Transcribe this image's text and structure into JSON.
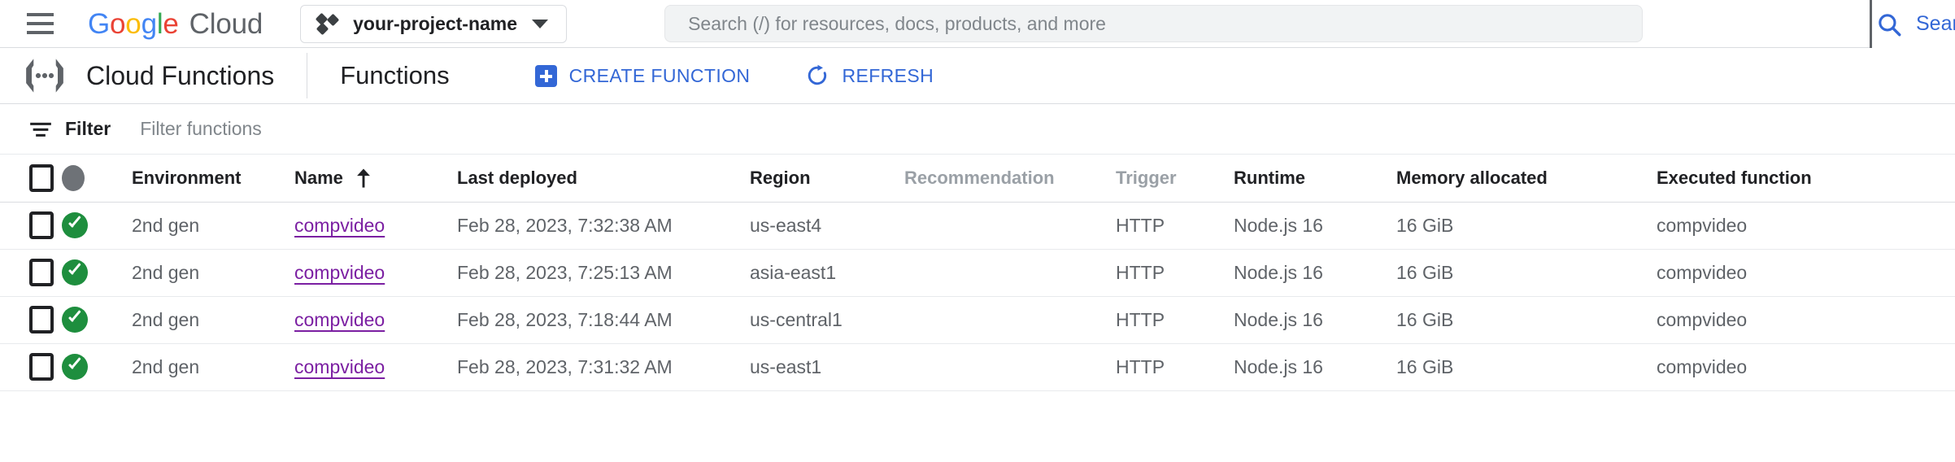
{
  "topbar": {
    "menu_icon": "hamburger-menu-icon",
    "logo": {
      "google_letters": [
        {
          "ch": "G",
          "color": "#4285f4"
        },
        {
          "ch": "o",
          "color": "#ea4335"
        },
        {
          "ch": "o",
          "color": "#fbbc05"
        },
        {
          "ch": "g",
          "color": "#4285f4"
        },
        {
          "ch": "l",
          "color": "#34a853"
        },
        {
          "ch": "e",
          "color": "#ea4335"
        }
      ],
      "cloud_word": "Cloud"
    },
    "project_selector": {
      "name": "your-project-name",
      "dropdown_icon": "chevron-down-icon",
      "project_icon": "project-dots-icon"
    },
    "search": {
      "placeholder": "Search (/) for resources, docs, products, and more",
      "value": ""
    },
    "search_button": {
      "label": "Search",
      "icon": "search-icon",
      "color": "#3367d6"
    }
  },
  "product_header": {
    "product_icon": "cloud-functions-icon",
    "product_name": "Cloud Functions",
    "page_title": "Functions",
    "actions": [
      {
        "label": "CREATE FUNCTION",
        "icon": "plus-box-icon",
        "color": "#3367d6"
      },
      {
        "label": "REFRESH",
        "icon": "refresh-icon",
        "color": "#3367d6"
      }
    ]
  },
  "filter_bar": {
    "icon": "filter-list-icon",
    "label": "Filter",
    "placeholder": "Filter functions",
    "value": ""
  },
  "table": {
    "select_all_checkbox": {
      "checked": false,
      "icon": "checkbox-unchecked-icon"
    },
    "status_header_icon": "status-circle-icon",
    "sort": {
      "column": "Name",
      "direction": "asc",
      "icon": "arrow-up-icon"
    },
    "columns": [
      {
        "key": "checkbox",
        "label": "",
        "dim": false
      },
      {
        "key": "status",
        "label": "",
        "dim": false
      },
      {
        "key": "environment",
        "label": "Environment",
        "dim": false
      },
      {
        "key": "name",
        "label": "Name",
        "dim": false
      },
      {
        "key": "last_deployed",
        "label": "Last deployed",
        "dim": false
      },
      {
        "key": "region",
        "label": "Region",
        "dim": false
      },
      {
        "key": "recommendation",
        "label": "Recommendation",
        "dim": true
      },
      {
        "key": "trigger",
        "label": "Trigger",
        "dim": true
      },
      {
        "key": "runtime",
        "label": "Runtime",
        "dim": false
      },
      {
        "key": "memory_allocated",
        "label": "Memory allocated",
        "dim": false
      },
      {
        "key": "executed_function",
        "label": "Executed function",
        "dim": false
      }
    ],
    "rows": [
      {
        "status": "ok",
        "status_icon": "check-circle-icon",
        "environment": "2nd gen",
        "name": "compvideo",
        "last_deployed": "Feb 28, 2023, 7:32:38 AM",
        "region": "us-east4",
        "recommendation": "",
        "trigger": "HTTP",
        "runtime": "Node.js 16",
        "memory_allocated": "16 GiB",
        "executed_function": "compvideo"
      },
      {
        "status": "ok",
        "status_icon": "check-circle-icon",
        "environment": "2nd gen",
        "name": "compvideo",
        "last_deployed": "Feb 28, 2023, 7:25:13 AM",
        "region": "asia-east1",
        "recommendation": "",
        "trigger": "HTTP",
        "runtime": "Node.js 16",
        "memory_allocated": "16 GiB",
        "executed_function": "compvideo"
      },
      {
        "status": "ok",
        "status_icon": "check-circle-icon",
        "environment": "2nd gen",
        "name": "compvideo",
        "last_deployed": "Feb 28, 2023, 7:18:44 AM",
        "region": "us-central1",
        "recommendation": "",
        "trigger": "HTTP",
        "runtime": "Node.js 16",
        "memory_allocated": "16 GiB",
        "executed_function": "compvideo"
      },
      {
        "status": "ok",
        "status_icon": "check-circle-icon",
        "environment": "2nd gen",
        "name": "compvideo",
        "last_deployed": "Feb 28, 2023, 7:31:32 AM",
        "region": "us-east1",
        "recommendation": "",
        "trigger": "HTTP",
        "runtime": "Node.js 16",
        "memory_allocated": "16 GiB",
        "executed_function": "compvideo"
      }
    ]
  },
  "colors": {
    "accent_blue": "#3367d6",
    "link_purple": "#7b1fa2",
    "status_green": "#1e8e3e",
    "text_primary": "#202124",
    "text_secondary": "#5f6368",
    "text_dim": "#9aa0a6",
    "border": "#dadce0"
  }
}
